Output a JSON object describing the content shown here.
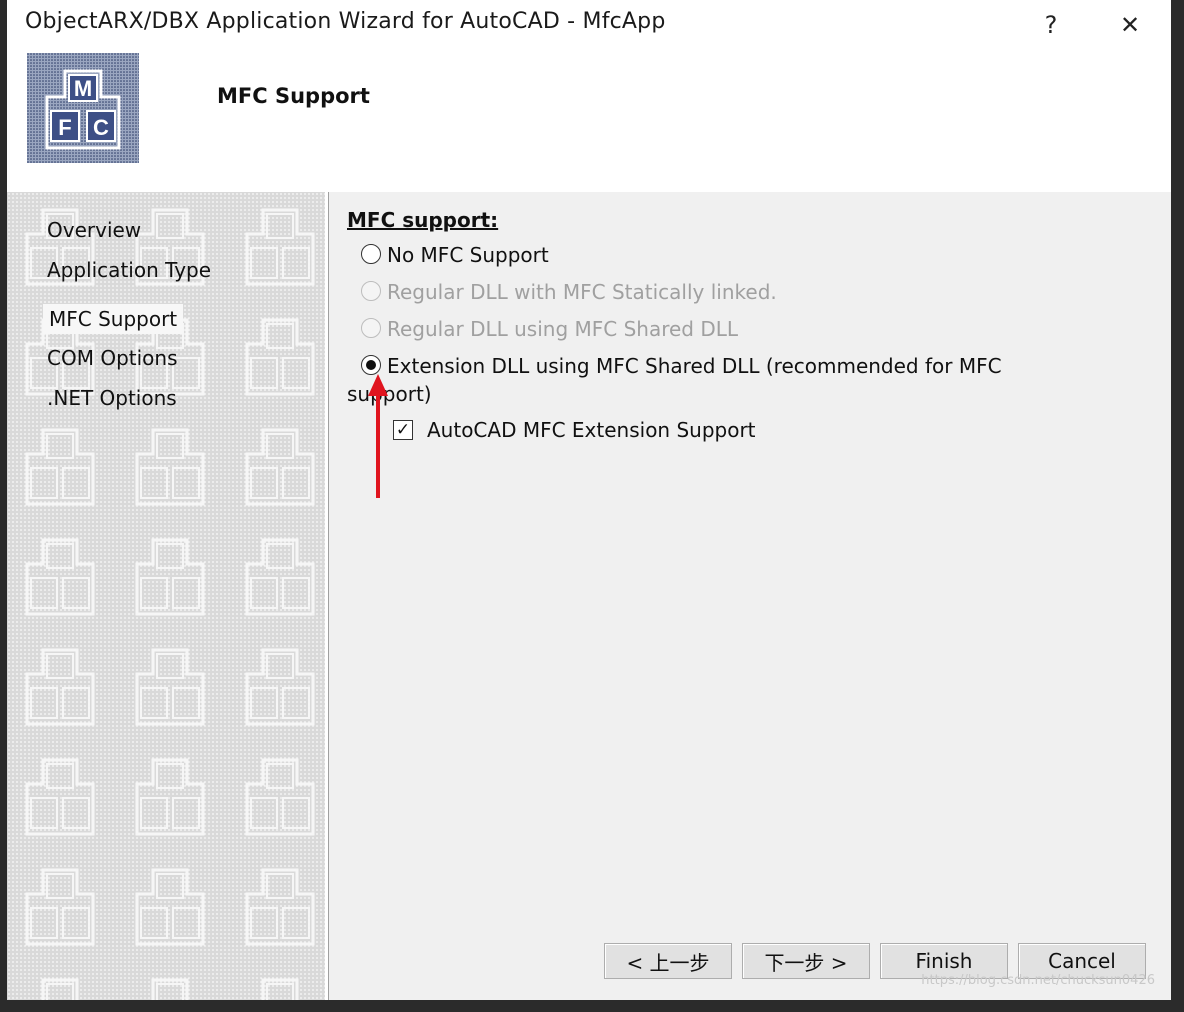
{
  "window": {
    "title": "ObjectARX/DBX Application Wizard for AutoCAD - MfcApp",
    "help_label": "?",
    "close_label": "✕"
  },
  "header": {
    "title": "MFC Support",
    "logo": {
      "top_letter": "M",
      "bottom_left_letter": "F",
      "bottom_right_letter": "C"
    }
  },
  "sidebar": {
    "items": [
      {
        "label": "Overview"
      },
      {
        "label": "Application Type"
      },
      {
        "label": "MFC Support",
        "active": true
      },
      {
        "label": "COM Options"
      },
      {
        "label": ".NET Options"
      }
    ]
  },
  "main": {
    "section_label": "MFC support:",
    "options": [
      {
        "label": "No MFC Support",
        "enabled": true,
        "selected": false
      },
      {
        "label": "Regular DLL with MFC Statically linked.",
        "enabled": false,
        "selected": false
      },
      {
        "label": "Regular DLL using MFC Shared DLL",
        "enabled": false,
        "selected": false
      },
      {
        "label": "Extension DLL using MFC Shared DLL (recommended for MFC",
        "enabled": true,
        "selected": true
      }
    ],
    "option_wrap_text": "support)",
    "checkbox": {
      "label": "AutoCAD MFC Extension Support",
      "checked": true,
      "mark": "✓"
    }
  },
  "footer": {
    "back_label": "< 上一步",
    "next_label": "下一步 >",
    "finish_label": "Finish",
    "cancel_label": "Cancel"
  },
  "annotation": {
    "color": "#e0141e",
    "icon": "red-arrow-up"
  },
  "watermark": "https://blog.csdn.net/chucksun0426",
  "colors": {
    "sidebar_bg": "#d9d9d9",
    "content_bg": "#f0f0f0",
    "button_bg": "#e1e1e1"
  }
}
